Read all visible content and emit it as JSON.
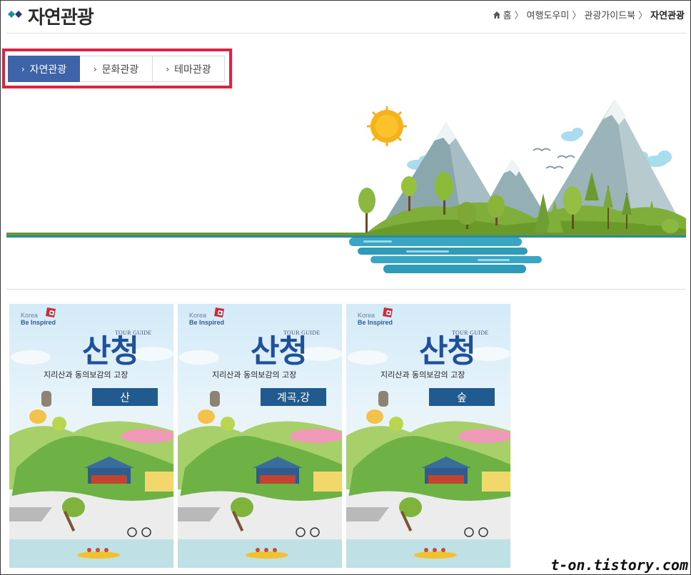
{
  "header": {
    "title": "자연관광",
    "breadcrumb": {
      "home": "홈",
      "items": [
        "여행도우미",
        "관광가이드북"
      ],
      "current": "자연관광",
      "separator": "〉"
    }
  },
  "tabs": [
    {
      "label": "자연관광",
      "active": true
    },
    {
      "label": "문화관광",
      "active": false
    },
    {
      "label": "테마관광",
      "active": false
    }
  ],
  "books": [
    {
      "brand_korea": "Korea",
      "brand_inspired": "Be Inspired",
      "tour_guide": "TOUR GUIDE",
      "title": "산청",
      "subtitle": "지리산과 동의보감의 고장",
      "category": "산"
    },
    {
      "brand_korea": "Korea",
      "brand_inspired": "Be Inspired",
      "tour_guide": "TOUR GUIDE",
      "title": "산청",
      "subtitle": "지리산과 동의보감의 고장",
      "category": "계곡,강"
    },
    {
      "brand_korea": "Korea",
      "brand_inspired": "Be Inspired",
      "tour_guide": "TOUR GUIDE",
      "title": "산청",
      "subtitle": "지리산과 동의보감의 고장",
      "category": "숲"
    }
  ],
  "watermark": "t-on.tistory.com",
  "colors": {
    "accent": "#3f63a8",
    "highlight_border": "#dc2442",
    "category_badge": "#215a8e",
    "title_blue": "#21509b"
  },
  "icons": [
    "diamond-bullet-icon",
    "home-icon",
    "chevron-right-icon",
    "korea-logo-icon"
  ]
}
